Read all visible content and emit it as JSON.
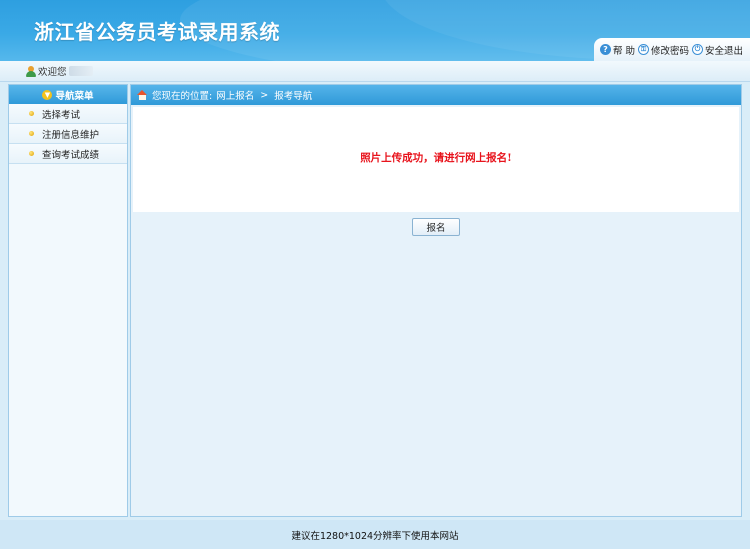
{
  "header": {
    "title": "浙江省公务员考试录用系统",
    "links": [
      {
        "label": "帮 助",
        "icon": "help-icon"
      },
      {
        "label": "修改密码",
        "icon": "key-icon"
      },
      {
        "label": "安全退出",
        "icon": "power-icon"
      }
    ]
  },
  "welcome": {
    "text": "欢迎您"
  },
  "sidebar": {
    "title": "导航菜单",
    "items": [
      {
        "label": "选择考试"
      },
      {
        "label": "注册信息维护"
      },
      {
        "label": "查询考试成绩"
      }
    ]
  },
  "main": {
    "breadcrumb": {
      "prefix": "您现在的位置:",
      "level1": "网上报名",
      "sep": ">",
      "level2": "报考导航"
    },
    "message": "照片上传成功，请进行网上报名!",
    "button_label": "报名"
  },
  "footer": {
    "text": "建议在1280*1024分辨率下使用本网站"
  },
  "colors": {
    "header_blue": "#2e9fe0",
    "message_red": "#e8141d",
    "panel_bg": "#e6f2fa"
  }
}
